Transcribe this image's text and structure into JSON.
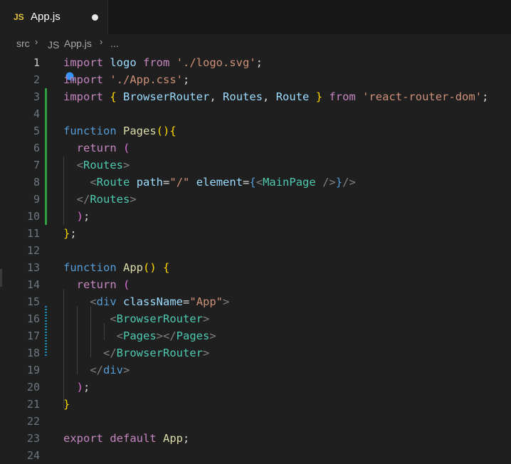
{
  "tab": {
    "badge": "JS",
    "label": "App.js"
  },
  "breadcrumb": {
    "folder": "src",
    "badge": "JS",
    "file": "App.js",
    "more": "..."
  },
  "lines": [
    {
      "n": "1",
      "t": [
        [
          "kc",
          "import"
        ],
        [
          "w",
          " "
        ],
        [
          "v",
          "logo"
        ],
        [
          "w",
          " "
        ],
        [
          "kc",
          "from"
        ],
        [
          "w",
          " "
        ],
        [
          "s",
          "'./logo.svg'"
        ],
        [
          "w",
          ";"
        ]
      ]
    },
    {
      "n": "2",
      "t": [
        [
          "kc",
          "import"
        ],
        [
          "w",
          " "
        ],
        [
          "s",
          "'./App.css'"
        ],
        [
          "w",
          ";"
        ]
      ]
    },
    {
      "n": "3",
      "t": [
        [
          "kc",
          "import"
        ],
        [
          "w",
          " "
        ],
        [
          "p1",
          "{"
        ],
        [
          "w",
          " "
        ],
        [
          "v",
          "BrowserRouter"
        ],
        [
          "w",
          ", "
        ],
        [
          "v",
          "Routes"
        ],
        [
          "w",
          ", "
        ],
        [
          "v",
          "Route"
        ],
        [
          "w",
          " "
        ],
        [
          "p1",
          "}"
        ],
        [
          "w",
          " "
        ],
        [
          "kc",
          "from"
        ],
        [
          "w",
          " "
        ],
        [
          "s",
          "'react-router-dom'"
        ],
        [
          "w",
          ";"
        ]
      ]
    },
    {
      "n": "4",
      "t": []
    },
    {
      "n": "5",
      "t": [
        [
          "k",
          "function"
        ],
        [
          "w",
          " "
        ],
        [
          "f",
          "Pages"
        ],
        [
          "p1",
          "()"
        ],
        [
          "p1",
          "{"
        ]
      ]
    },
    {
      "n": "6",
      "t": [
        [
          "w",
          "  "
        ],
        [
          "kc",
          "return"
        ],
        [
          "w",
          " "
        ],
        [
          "p2",
          "("
        ]
      ]
    },
    {
      "n": "7",
      "t": [
        [
          "w",
          "  "
        ],
        [
          "tg",
          "<"
        ],
        [
          "t",
          "Routes"
        ],
        [
          "tg",
          ">"
        ]
      ]
    },
    {
      "n": "8",
      "t": [
        [
          "w",
          "    "
        ],
        [
          "tg",
          "<"
        ],
        [
          "t",
          "Route"
        ],
        [
          "w",
          " "
        ],
        [
          "v",
          "path"
        ],
        [
          "w",
          "="
        ],
        [
          "s",
          "\"/\""
        ],
        [
          "w",
          " "
        ],
        [
          "v",
          "element"
        ],
        [
          "w",
          "="
        ],
        [
          "k",
          "{"
        ],
        [
          "tg",
          "<"
        ],
        [
          "t",
          "MainPage"
        ],
        [
          "w",
          " "
        ],
        [
          "tg",
          "/>"
        ],
        [
          "k",
          "}"
        ],
        [
          "tg",
          "/>"
        ]
      ]
    },
    {
      "n": "9",
      "t": [
        [
          "w",
          "  "
        ],
        [
          "tg",
          "</"
        ],
        [
          "t",
          "Routes"
        ],
        [
          "tg",
          ">"
        ]
      ]
    },
    {
      "n": "10",
      "t": [
        [
          "w",
          "  "
        ],
        [
          "p2",
          ")"
        ],
        [
          "w",
          ";"
        ]
      ]
    },
    {
      "n": "11",
      "t": [
        [
          "p1",
          "}"
        ],
        [
          "w",
          ";"
        ]
      ]
    },
    {
      "n": "12",
      "t": []
    },
    {
      "n": "13",
      "t": [
        [
          "k",
          "function"
        ],
        [
          "w",
          " "
        ],
        [
          "f",
          "App"
        ],
        [
          "p1",
          "()"
        ],
        [
          "w",
          " "
        ],
        [
          "p1",
          "{"
        ]
      ]
    },
    {
      "n": "14",
      "t": [
        [
          "w",
          "  "
        ],
        [
          "kc",
          "return"
        ],
        [
          "w",
          " "
        ],
        [
          "p2",
          "("
        ]
      ]
    },
    {
      "n": "15",
      "t": [
        [
          "w",
          "    "
        ],
        [
          "tg",
          "<"
        ],
        [
          "k",
          "div"
        ],
        [
          "w",
          " "
        ],
        [
          "v",
          "className"
        ],
        [
          "w",
          "="
        ],
        [
          "s",
          "\"App\""
        ],
        [
          "tg",
          ">"
        ]
      ]
    },
    {
      "n": "16",
      "t": [
        [
          "w",
          "       "
        ],
        [
          "tg",
          "<"
        ],
        [
          "t",
          "BrowserRouter"
        ],
        [
          "tg",
          ">"
        ]
      ]
    },
    {
      "n": "17",
      "t": [
        [
          "w",
          "        "
        ],
        [
          "tg",
          "<"
        ],
        [
          "t",
          "Pages"
        ],
        [
          "tg",
          "></"
        ],
        [
          "t",
          "Pages"
        ],
        [
          "tg",
          ">"
        ]
      ]
    },
    {
      "n": "18",
      "t": [
        [
          "w",
          "      "
        ],
        [
          "tg",
          "</"
        ],
        [
          "t",
          "BrowserRouter"
        ],
        [
          "tg",
          ">"
        ]
      ]
    },
    {
      "n": "19",
      "t": [
        [
          "w",
          "    "
        ],
        [
          "tg",
          "</"
        ],
        [
          "k",
          "div"
        ],
        [
          "tg",
          ">"
        ]
      ]
    },
    {
      "n": "20",
      "t": [
        [
          "w",
          "  "
        ],
        [
          "p2",
          ")"
        ],
        [
          "w",
          ";"
        ]
      ]
    },
    {
      "n": "21",
      "t": [
        [
          "p1",
          "}"
        ]
      ]
    },
    {
      "n": "22",
      "t": []
    },
    {
      "n": "23",
      "t": [
        [
          "kc",
          "export"
        ],
        [
          "w",
          " "
        ],
        [
          "kc",
          "default"
        ],
        [
          "w",
          " "
        ],
        [
          "f",
          "App"
        ],
        [
          "w",
          ";"
        ]
      ]
    },
    {
      "n": "24",
      "t": []
    }
  ],
  "active_line": "1",
  "icons": {
    "tab_dirty": "unsaved-dot-icon",
    "lightbulb": "lightbulb-icon",
    "breadcrumb_sep": "chevron-right-icon"
  },
  "colors": {
    "editor_bg": "#1f1f1f",
    "keyword": "#569cd6",
    "control_keyword": "#c586c0",
    "string": "#ce9178",
    "function": "#dcdcaa",
    "variable": "#9cdcfe",
    "component": "#4ec9b0",
    "git_added": "#2ea043",
    "git_modified": "#1b81a8"
  }
}
